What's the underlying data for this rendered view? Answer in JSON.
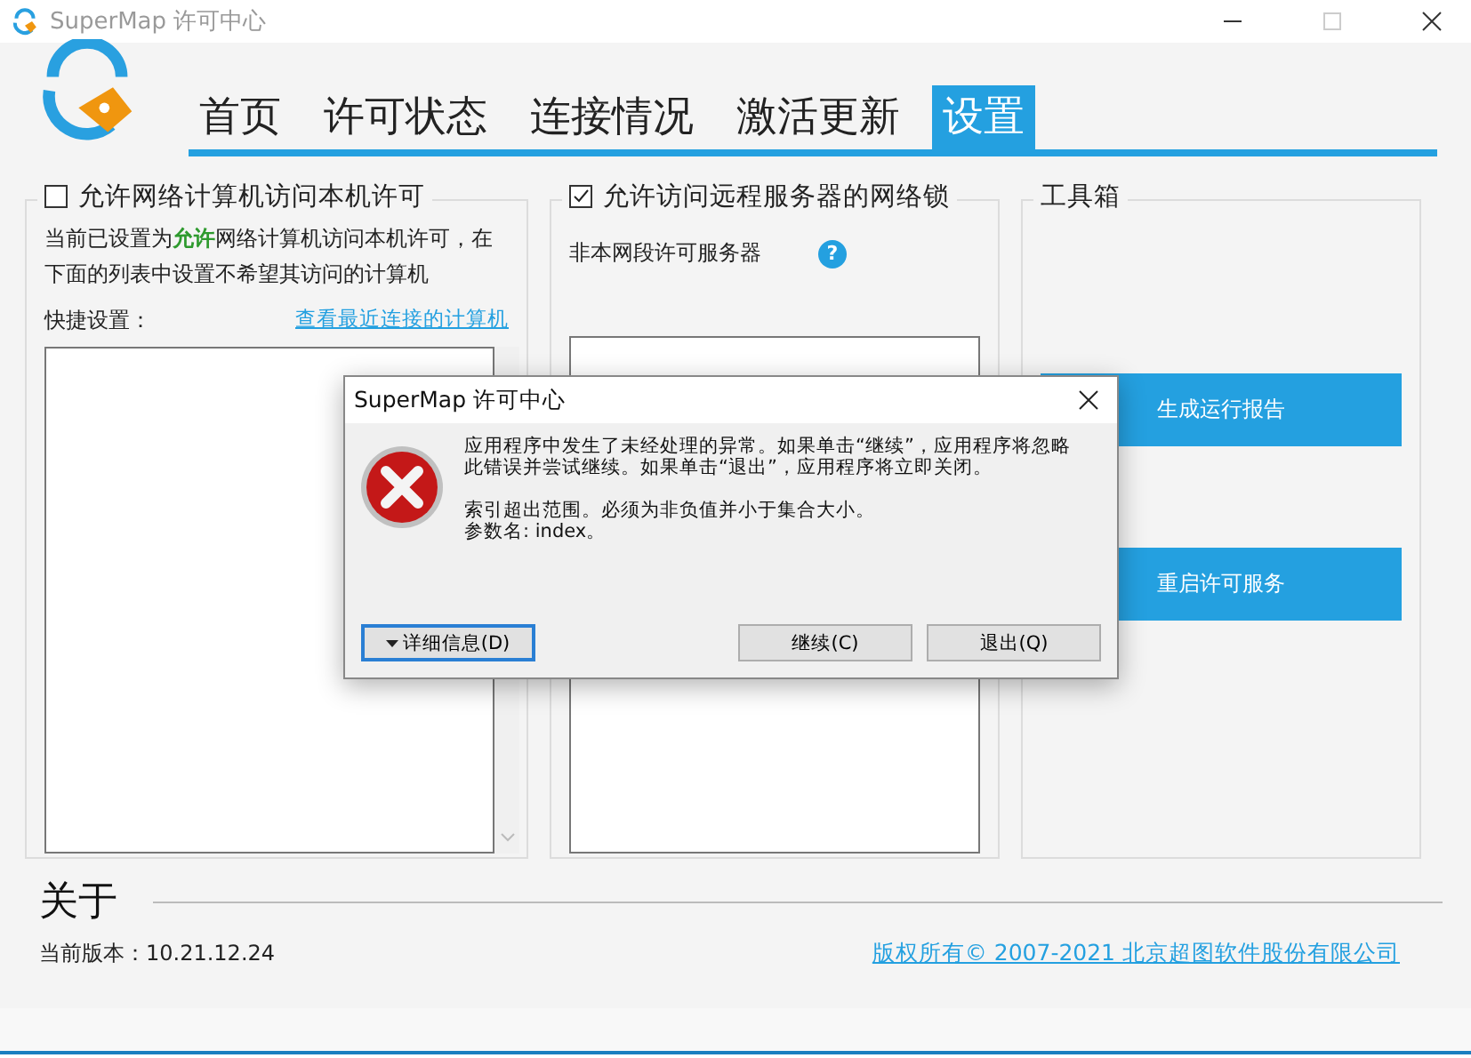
{
  "window": {
    "title": "SuperMap 许可中心"
  },
  "tabs": [
    {
      "label": "首页",
      "selected": false
    },
    {
      "label": "许可状态",
      "selected": false
    },
    {
      "label": "连接情况",
      "selected": false
    },
    {
      "label": "激活更新",
      "selected": false
    },
    {
      "label": "设置",
      "selected": true
    }
  ],
  "local_access": {
    "label": "允许网络计算机访问本机许可",
    "checked": false,
    "description": "当前已设置为**允许**网络计算机访问本机许可，在下面的列表中设置不希望其访问的计算机",
    "quick_label": "快捷设置：",
    "recent_link": "查看最近连接的计算机"
  },
  "remote_access": {
    "label": "允许访问远程服务器的网络锁",
    "checked": true,
    "servers_label": "非本网段许可服务器",
    "help": "?"
  },
  "toolbox": {
    "title": "工具箱",
    "buttons": [
      "生成运行报告",
      "重启许可服务"
    ]
  },
  "about": {
    "title": "关于",
    "version": "当前版本：10.21.12.24",
    "copyright": "版权所有© 2007-2021 北京超图软件股份有限公司"
  },
  "dialog": {
    "title": "SuperMap 许可中心",
    "message": "应用程序中发生了未经处理的异常。如果单击“继续”，应用程序将忽略此错误并尝试继续。如果单击“退出”，应用程序将立即关闭。",
    "detail": [
      "索引超出范围。必须为非负值并小于集合大小。",
      "参数名: index。"
    ],
    "details_button": "详细信息(D)",
    "buttons": [
      "继续(C)",
      "退出(Q)"
    ]
  }
}
